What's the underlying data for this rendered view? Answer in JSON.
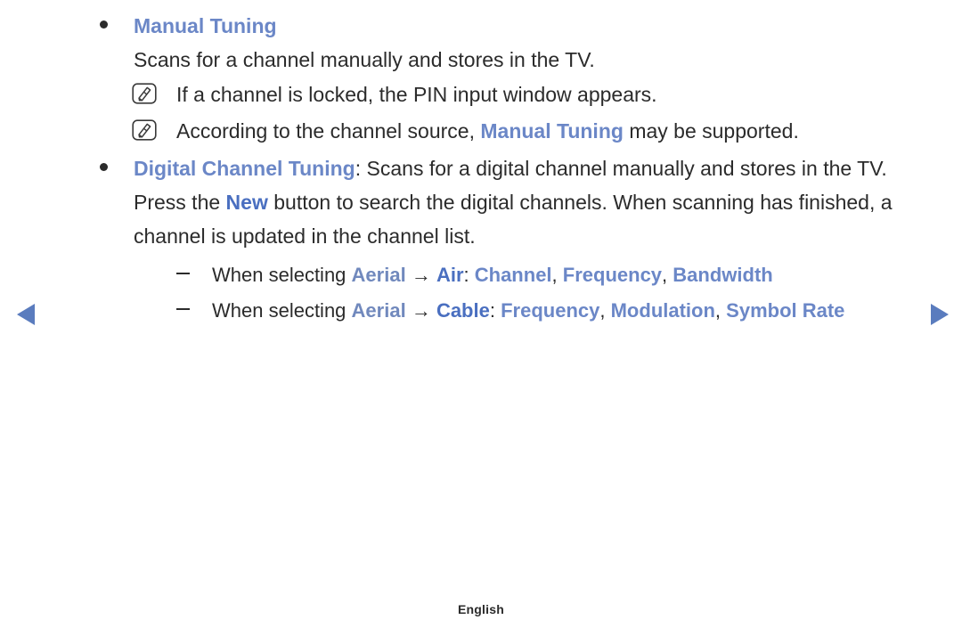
{
  "colors": {
    "accent_blue": "#6b87c7",
    "accent_blue_strong": "#4a6fc0",
    "text": "#2b2b2b",
    "background": "#ffffff"
  },
  "nav": {
    "prev_icon": "triangle-left-icon",
    "next_icon": "triangle-right-icon",
    "prev_label": "Previous page",
    "next_label": "Next page"
  },
  "footer": {
    "language": "English"
  },
  "content": {
    "heading_bullet": "●",
    "heading": "Manual Tuning",
    "description": "Scans for a channel manually and stores in the TV.",
    "notes": [
      {
        "icon": "note-pencil-icon",
        "text": "If a channel is locked, the PIN input window appears."
      },
      {
        "icon": "note-pencil-icon",
        "text_before": "According to the channel source, ",
        "term": "Manual Tuning",
        "text_after": " may be supported."
      }
    ],
    "digital": {
      "bullet": "●",
      "term": "Digital Channel Tuning",
      "colon": ":",
      "line1_rest": " Scans for a digital channel manually and stores",
      "line2_before": "in the TV. Press the ",
      "line2_term": "New",
      "line2_after": " button to search the digital channels. When",
      "line3": "scanning has finished, a channel is updated in the channel list."
    },
    "sub_items": [
      {
        "marker": "–",
        "prefix": "When selecting ",
        "source": "Aerial",
        "arrow": "→",
        "mode": "Air",
        "colon": ":",
        "fields": [
          "Channel",
          "Frequency",
          "Bandwidth"
        ],
        "separator": ", "
      },
      {
        "marker": "–",
        "prefix": "When selecting ",
        "source": "Aerial",
        "arrow": "→",
        "mode": "Cable",
        "colon": ":",
        "fields": [
          "Frequency",
          "Modulation",
          "Symbol Rate"
        ],
        "separator": ", "
      }
    ]
  }
}
